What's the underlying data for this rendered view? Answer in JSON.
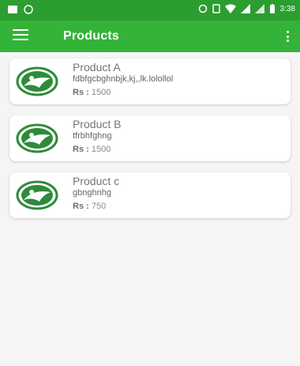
{
  "status": {
    "time": "3:38"
  },
  "appbar": {
    "title": "Products",
    "menu_icon": "hamburger-menu-icon",
    "more_icon": "more-vert-icon"
  },
  "products": [
    {
      "name": "Product A",
      "description": "fdbfgcbghnbjk,kj,,lk.lolollol",
      "currency": "Rs :",
      "price": "1500"
    },
    {
      "name": "Product B",
      "description": "tfrbhfghng",
      "currency": "Rs :",
      "price": "1500"
    },
    {
      "name": "Product c",
      "description": "gbnghnhg",
      "currency": "Rs :",
      "price": "750"
    }
  ],
  "colors": {
    "status_bar": "#2b9e2f",
    "app_bar": "#34b339",
    "logo_green": "#2e8b3a"
  }
}
